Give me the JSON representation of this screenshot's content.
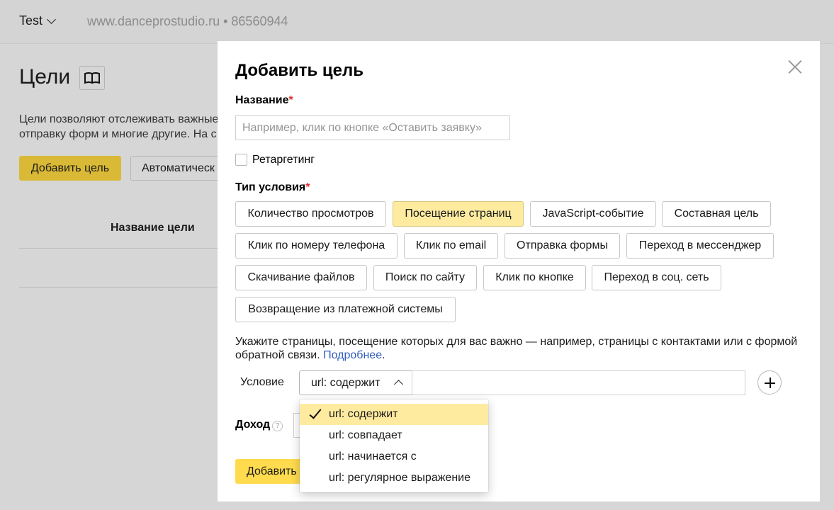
{
  "header": {
    "counter_name": "Test",
    "site_info": "www.danceprostudio.ru • 86560944"
  },
  "goals_page": {
    "title": "Цели",
    "desc_line1": "Цели позволяют отслеживать важные",
    "desc_line2": "отправку форм и многие другие. На с",
    "add_button": "Добавить цель",
    "auto_button": "Автоматическ",
    "column_header": "Название цели"
  },
  "modal": {
    "title": "Добавить цель",
    "name_label": "Название",
    "required_mark": "*",
    "name_placeholder": "Например, клик по кнопке «Оставить заявку»",
    "retargeting_label": "Ретаргетинг",
    "condition_type_label": "Тип условия",
    "condition_types": [
      "Количество просмотров",
      "Посещение страниц",
      "JavaScript-событие",
      "Составная цель",
      "Клик по номеру телефона",
      "Клик по email",
      "Отправка формы",
      "Переход в мессенджер",
      "Скачивание файлов",
      "Поиск по сайту",
      "Клик по кнопке",
      "Переход в соц. сеть",
      "Возвращение из платежной системы"
    ],
    "active_condition_type": "Посещение страниц",
    "help_text": "Укажите страницы, посещение которых для вас важно — например, страницы с контактами или с формой обратной связи.",
    "help_link": "Подробнее",
    "help_period": ".",
    "condition_label": "Условие",
    "condition_selected": "url: содержит",
    "condition_value": "",
    "income_label": "Доход",
    "income_help": "?",
    "submit_button": "Добавить"
  },
  "dropdown": {
    "options": [
      "url: содержит",
      "url: совпадает",
      "url: начинается с",
      "url: регулярное выражение"
    ],
    "selected": "url: содержит"
  },
  "icons": {
    "book": "book-icon",
    "close": "close-icon",
    "plus": "plus-icon",
    "check": "check-icon",
    "chevron": "chevron-icon"
  },
  "colors": {
    "accent_yellow": "#ffdb4d",
    "active_chip": "#ffeba0",
    "link": "#2e5dbd",
    "required": "#e03030"
  }
}
